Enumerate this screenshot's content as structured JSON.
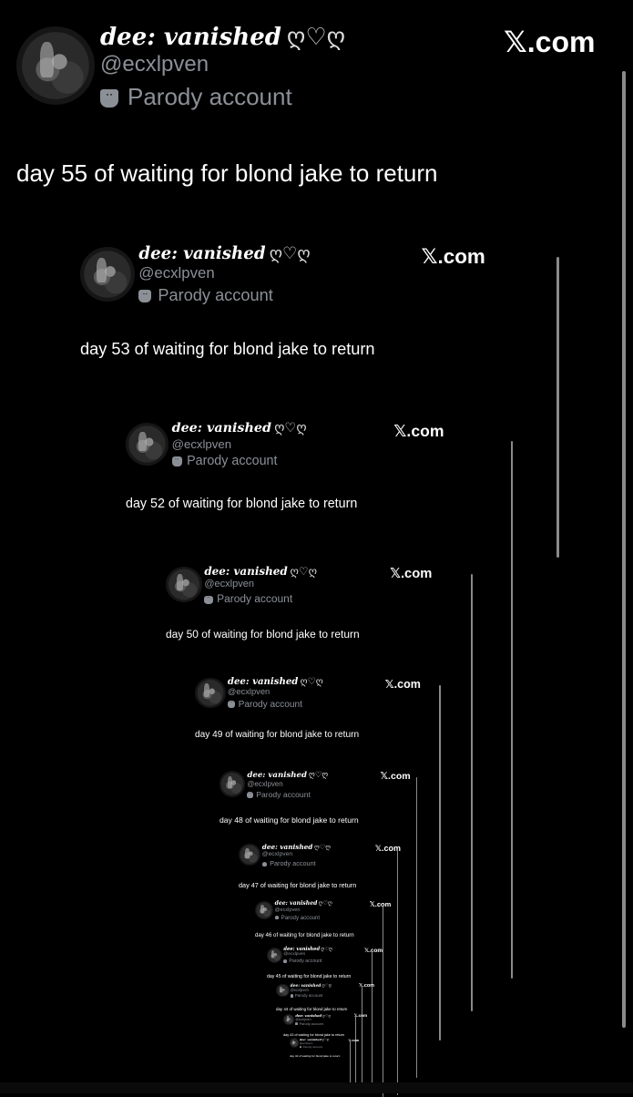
{
  "account": {
    "display_name": "dee: vanished",
    "name_decoration": "ღ♡ღ",
    "handle": "@ecxlpven",
    "label": "Parody account",
    "label_icon": "mask-icon"
  },
  "watermark": "𝕏.com",
  "posts": [
    {
      "text": "day 55 of waiting for blond jake to return"
    },
    {
      "text": "day 53 of waiting for blond jake to return"
    },
    {
      "text": "day 52 of waiting for blond jake to return"
    },
    {
      "text": "day 50 of waiting for blond jake to return"
    },
    {
      "text": "day 49 of waiting for blond jake to return"
    },
    {
      "text": "day 48 of waiting for blond jake to return"
    },
    {
      "text": "day 47 of waiting for blond jake to return"
    },
    {
      "text": "day 46 of waiting for blond jake to return"
    },
    {
      "text": "day 45 of waiting for blond jake to return"
    },
    {
      "text": "day 44 of waiting for blond jake to return"
    },
    {
      "text": "day 43 of waiting for blond jake to return"
    },
    {
      "text": "day 42 of waiting for blond jake to return"
    }
  ],
  "colors": {
    "background": "#000000",
    "text": "#ffffff",
    "secondary": "#8b9097"
  }
}
